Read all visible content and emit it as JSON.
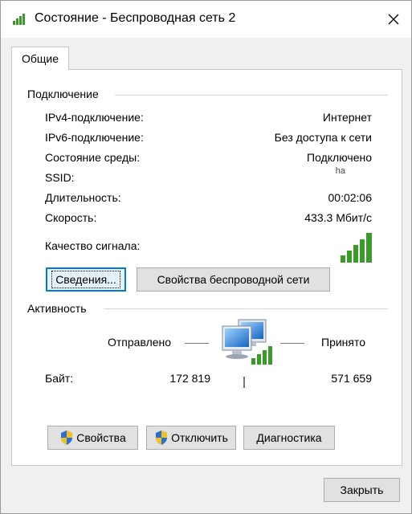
{
  "window": {
    "title": "Состояние - Беспроводная сеть 2",
    "close_glyph": "✕"
  },
  "tab": {
    "label": "Общие"
  },
  "connection": {
    "group_title": "Подключение",
    "rows": [
      {
        "label": "IPv4-подключение:",
        "value": "Интернет"
      },
      {
        "label": "IPv6-подключение:",
        "value": "Без доступа к сети"
      },
      {
        "label": "Состояние среды:",
        "value": "Подключено"
      },
      {
        "label": "SSID:",
        "value": "ha"
      },
      {
        "label": "Длительность:",
        "value": "00:02:06"
      },
      {
        "label": "Скорость:",
        "value": "433.3 Мбит/с"
      }
    ],
    "signal_label": "Качество сигнала:",
    "signal_level": 5,
    "signal_max": 5,
    "details_button": "Сведения...",
    "wireless_props_button": "Свойства беспроводной сети"
  },
  "activity": {
    "group_title": "Активность",
    "sent_label": "Отправлено",
    "received_label": "Принято",
    "bytes_label": "Байт:",
    "bytes_sent": "172 819",
    "bytes_received": "571 659"
  },
  "buttons": {
    "properties": "Свойства",
    "disconnect": "Отключить",
    "diagnostics": "Диагностика",
    "close": "Закрыть"
  },
  "colors": {
    "signal_green": "#3a9a2a",
    "focus_blue": "#0078d7"
  },
  "icons": {
    "title": "wifi-signal-icon",
    "network": "network-computers-icon",
    "shield": "uac-shield-icon"
  }
}
